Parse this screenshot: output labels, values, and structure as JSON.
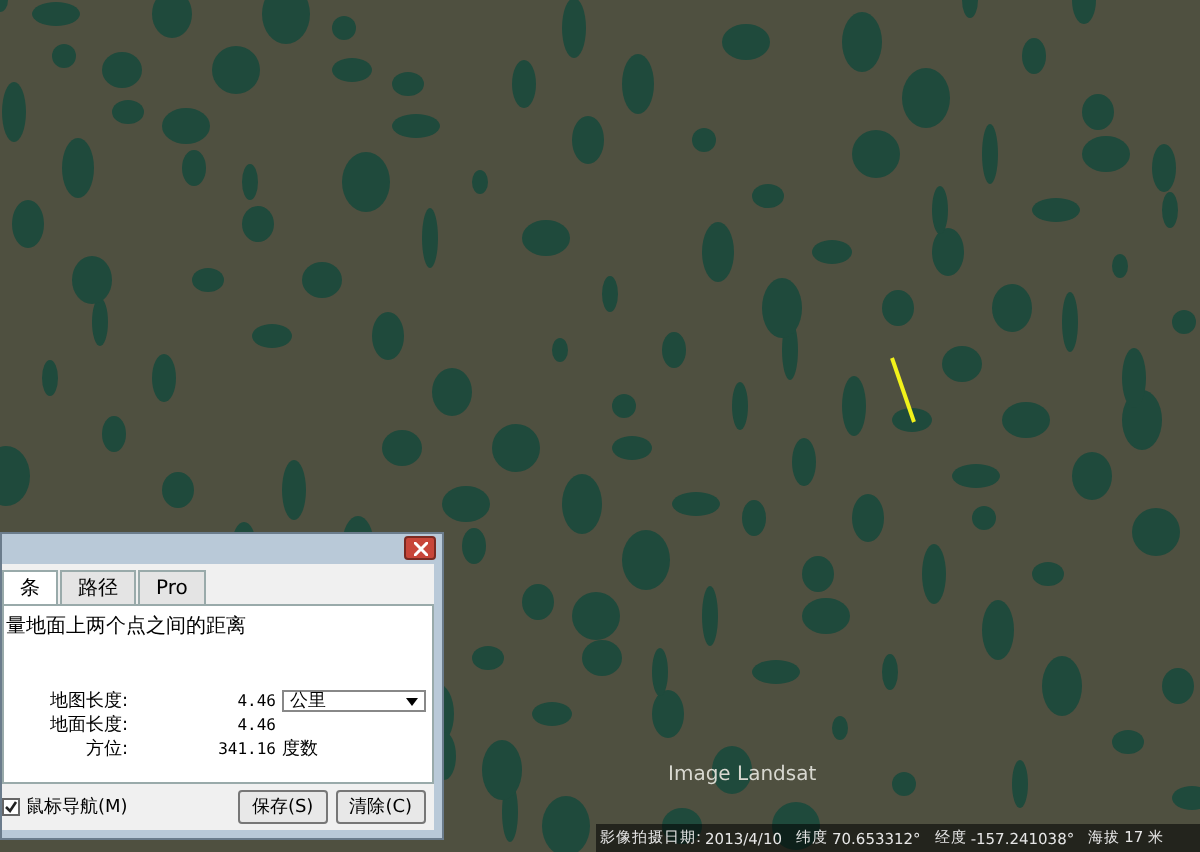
{
  "map": {
    "attribution": "Image Landsat"
  },
  "dialog": {
    "tabs": [
      {
        "label": "条",
        "selected": true
      },
      {
        "label": "路径",
        "selected": false
      },
      {
        "label": "Pro",
        "selected": false
      }
    ],
    "description": "量地面上两个点之间的距离",
    "fields": [
      {
        "label": "地图长度:",
        "value": "4.46",
        "unit": "公里",
        "kind": "dropdown"
      },
      {
        "label": "地面长度:",
        "value": "4.46",
        "kind": "plain"
      },
      {
        "label": "方位:",
        "value": "341.16",
        "unit": "度数",
        "kind": "unit"
      }
    ],
    "mouse_nav": {
      "label": "鼠标导航(M)",
      "checked": true
    },
    "buttons": [
      "保存(S)",
      "清除(C)"
    ]
  },
  "status_bar": {
    "date_label": "影像拍摄日期:",
    "date": "2013/4/10",
    "lat_label": "纬度",
    "lat": "70.653312°",
    "lon_label": "经度",
    "lon": "-157.241038°",
    "alt_label": "海拔",
    "alt": "17 米"
  }
}
